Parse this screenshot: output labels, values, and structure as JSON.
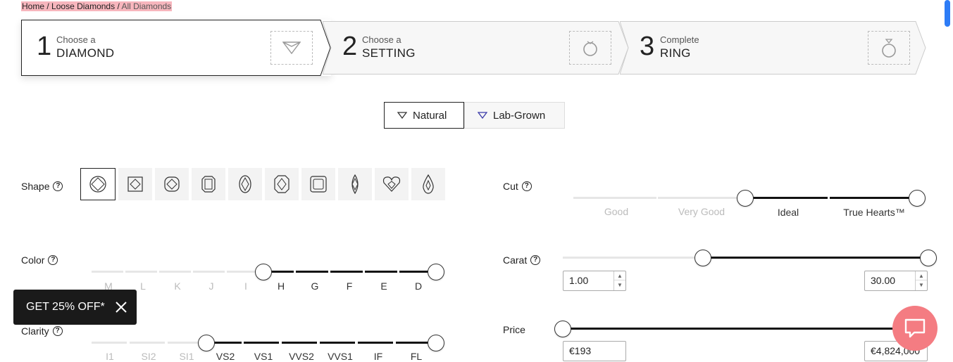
{
  "breadcrumb": {
    "home": "Home",
    "sep1": "/",
    "loose": "Loose Diamonds",
    "sep2": "/",
    "current": "All Diamonds"
  },
  "steps": [
    {
      "number": "1",
      "small": "Choose a",
      "big": "DIAMOND",
      "icon": "diamond-icon"
    },
    {
      "number": "2",
      "small": "Choose a",
      "big": "SETTING",
      "icon": "ring-setting-icon"
    },
    {
      "number": "3",
      "small": "Complete",
      "big": "RING",
      "icon": "diamond-ring-icon"
    }
  ],
  "toggle": {
    "natural": "Natural",
    "lab": "Lab-Grown",
    "selected": "Natural"
  },
  "filters": {
    "shape": {
      "label": "Shape",
      "help": "?",
      "selected": "Round",
      "icons": [
        "round-icon",
        "princess-icon",
        "cushion-icon",
        "emerald-icon",
        "oval-icon",
        "asscher-icon",
        "radiant-icon",
        "marquise-icon",
        "heart-icon",
        "pear-icon"
      ]
    },
    "cut": {
      "label": "Cut",
      "help": "?",
      "ticks": [
        "Good",
        "Very Good",
        "Ideal",
        "True Hearts™"
      ],
      "range": [
        "Ideal",
        "True Hearts™"
      ]
    },
    "color": {
      "label": "Color",
      "help": "?",
      "ticks": [
        "M",
        "L",
        "K",
        "J",
        "I",
        "H",
        "G",
        "F",
        "E",
        "D"
      ],
      "range": [
        "H",
        "D"
      ]
    },
    "carat": {
      "label": "Carat",
      "help": "?",
      "min": "1.00",
      "max": "30.00",
      "range_fraction": [
        0.38,
        1.0
      ]
    },
    "clarity": {
      "label": "Clarity",
      "help": "?",
      "ticks": [
        "I1",
        "SI2",
        "SI1",
        "VS2",
        "VS1",
        "VVS2",
        "VVS1",
        "IF",
        "FL"
      ],
      "range": [
        "VS2",
        "FL"
      ]
    },
    "price": {
      "label": "Price",
      "min": "€193",
      "max": "€4,824,000",
      "range_fraction": [
        0.0,
        1.0
      ]
    }
  },
  "promo": {
    "text": "GET 25% OFF*",
    "close": "×"
  },
  "chat": {
    "icon": "chat-icon"
  },
  "colors": {
    "accent_pink": "#f47c82",
    "breadcrumb_bg": "#f7b6bd",
    "active_track": "#111111",
    "scroll_thumb": "#2d7cf6"
  }
}
